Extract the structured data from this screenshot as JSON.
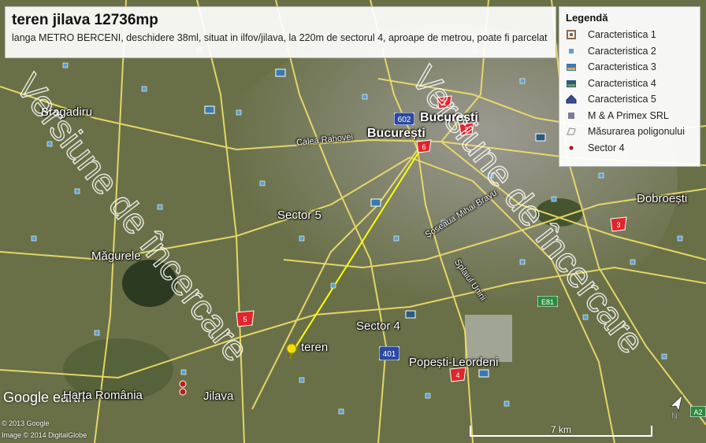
{
  "title_box": {
    "title": "teren jilava 12736mp",
    "description": "langa METRO BERCENI, deschidere 38ml, situat in ilfov/jilava, la 220m de sectorul 4, aproape de metrou, poate fi parcelat"
  },
  "legend": {
    "title": "Legendă",
    "items": [
      {
        "label": "Caracteristica 1",
        "icon": "square-marker-icon",
        "color": "#8a6a4a"
      },
      {
        "label": "Caracteristica 2",
        "icon": "dot-marker-icon",
        "color": "#5aa0d0"
      },
      {
        "label": "Caracteristica 3",
        "icon": "photo-marker-icon",
        "color": "#3a7ab0"
      },
      {
        "label": "Caracteristica 4",
        "icon": "photo-marker-icon",
        "color": "#2a5a80"
      },
      {
        "label": "Caracteristica 5",
        "icon": "house-marker-icon",
        "color": "#3a4a9a"
      },
      {
        "label": "M & A Primex SRL",
        "icon": "grid-marker-icon",
        "color": "#7a7a9a"
      },
      {
        "label": "Măsurarea poligonului",
        "icon": "polygon-icon",
        "color": "#999999"
      },
      {
        "label": "Sector 4",
        "icon": "small-dot-icon",
        "color": "#b01010"
      }
    ]
  },
  "places": [
    {
      "name": "București",
      "key": "bucuresti-top"
    },
    {
      "name": "București",
      "key": "bucuresti"
    },
    {
      "name": "Calea Rahovei",
      "key": "calea-rahovei"
    },
    {
      "name": "Bragadiru",
      "key": "bragadiru"
    },
    {
      "name": "Sector 5",
      "key": "sector-5"
    },
    {
      "name": "Dobroești",
      "key": "dobroesti"
    },
    {
      "name": "Măgurele",
      "key": "magurele"
    },
    {
      "name": "Sector 4",
      "key": "sector-4"
    },
    {
      "name": "teren",
      "key": "teren"
    },
    {
      "name": "Popești-Leordeni",
      "key": "popesti-leordeni"
    },
    {
      "name": "Jilava",
      "key": "jilava"
    },
    {
      "name": "Şoseaua Mihai Bravu",
      "key": "sos-mihai-bravu"
    },
    {
      "name": "Splaiul Unirii",
      "key": "splaiul-unirii"
    }
  ],
  "sector_markers": [
    "1",
    "2",
    "3",
    "4",
    "5",
    "6"
  ],
  "shields": [
    "602",
    "401",
    "E81",
    "A2"
  ],
  "watermark": "Versiune de încercare",
  "logo": {
    "main": "Google earth",
    "sub": "Harta România"
  },
  "copyright": [
    "© 2013 Google",
    "Image © 2014 DigitalGlobe"
  ],
  "scale": "7 km",
  "colors": {
    "road": "#f2e06a",
    "measure_line": "#ffff00",
    "sector_marker": "#e0262b"
  }
}
